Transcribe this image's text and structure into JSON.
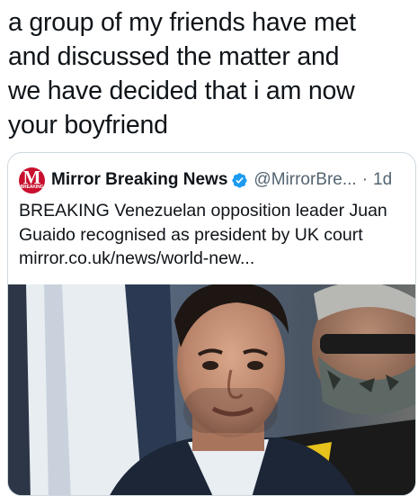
{
  "tweet": {
    "text_lines": [
      "a group of my friends have met",
      "and discussed the matter and",
      "we have decided that i am now",
      "your boyfriend"
    ]
  },
  "quoted": {
    "avatar_letter": "M",
    "avatar_tag": "BREAKING",
    "author": "Mirror Breaking News",
    "handle": "@MirrorBre...",
    "separator": "·",
    "time": "1d",
    "body_lines": [
      "BREAKING Venezuelan opposition leader Juan",
      "Guaido recognised as president by UK court",
      "mirror.co.uk/news/world-new..."
    ],
    "verified_icon": "verified-badge-icon",
    "brand_color": "#c8102e",
    "verified_color": "#1d9bf0"
  }
}
